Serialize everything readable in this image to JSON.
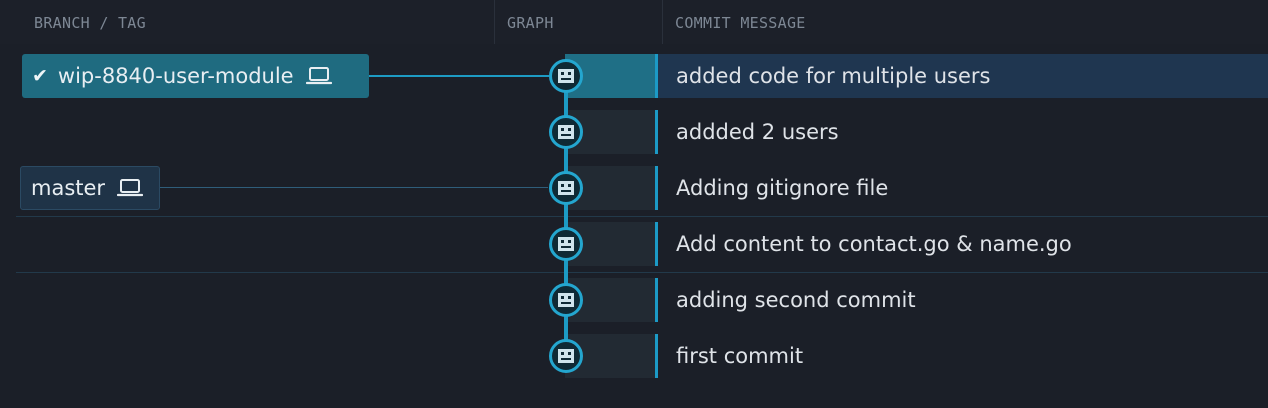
{
  "header": {
    "branch_tag": "BRANCH / TAG",
    "graph": "GRAPH",
    "commit_message": "COMMIT MESSAGE"
  },
  "branches": [
    {
      "label": "wip-8840-user-module",
      "checked_out": true,
      "icon": "laptop-icon"
    },
    {
      "label": "master",
      "checked_out": false,
      "icon": "laptop-icon"
    }
  ],
  "commits": [
    {
      "message": "added code for multiple users",
      "selected": true
    },
    {
      "message": "addded 2 users",
      "selected": false
    },
    {
      "message": "Adding gitignore file",
      "selected": false
    },
    {
      "message": "Add content to contact.go & name.go",
      "selected": false
    },
    {
      "message": "adding second commit",
      "selected": false
    },
    {
      "message": "first commit",
      "selected": false
    }
  ],
  "colors": {
    "accent": "#1d9bc4",
    "selected_row": "#1f3650",
    "active_branch": "#1f6b80",
    "background": "#1b1f28"
  }
}
